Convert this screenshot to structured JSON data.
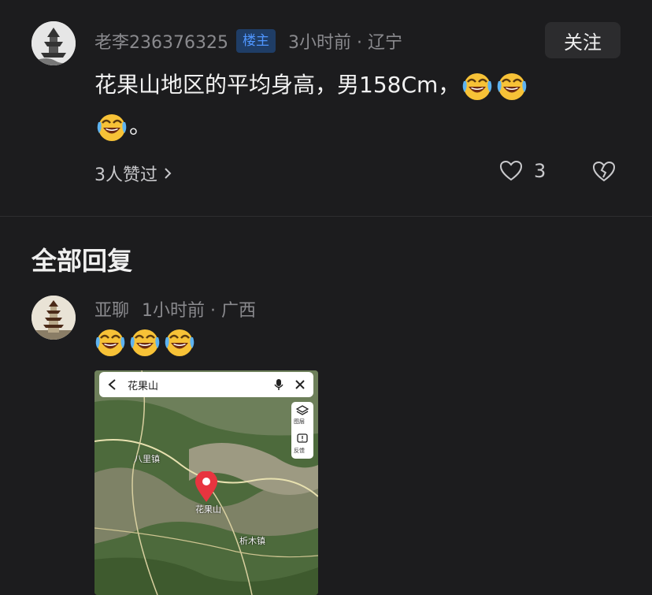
{
  "post": {
    "username": "老李236376325",
    "badge": "楼主",
    "meta": "3小时前 · 辽宁",
    "follow_label": "关注",
    "text": "花果山地区的平均身高，男158Cm，",
    "text_tail": "。",
    "emoji_count": 3,
    "likes_link": "3人赞过",
    "like_count": "3"
  },
  "section": {
    "title": "全部回复"
  },
  "reply": {
    "username": "亚聊",
    "meta": "1小时前 · 广西",
    "emoji_count": 3,
    "map": {
      "search_text": "花果山",
      "tool_layers_label": "图层",
      "tool_report_label": "反馈",
      "place_labels": [
        "八里镇",
        "花果山",
        "析木镇"
      ]
    }
  },
  "colors": {
    "background": "#1c1c1e",
    "badge_bg": "#1f3d66",
    "badge_text": "#4f96ff",
    "pin": "#e8343f"
  },
  "icons": [
    "laughing-crying-emoji",
    "chevron-right-icon",
    "heart-icon",
    "broken-heart-icon",
    "back-arrow-icon",
    "mic-icon",
    "close-icon",
    "layers-icon",
    "report-icon",
    "map-pin-icon"
  ]
}
